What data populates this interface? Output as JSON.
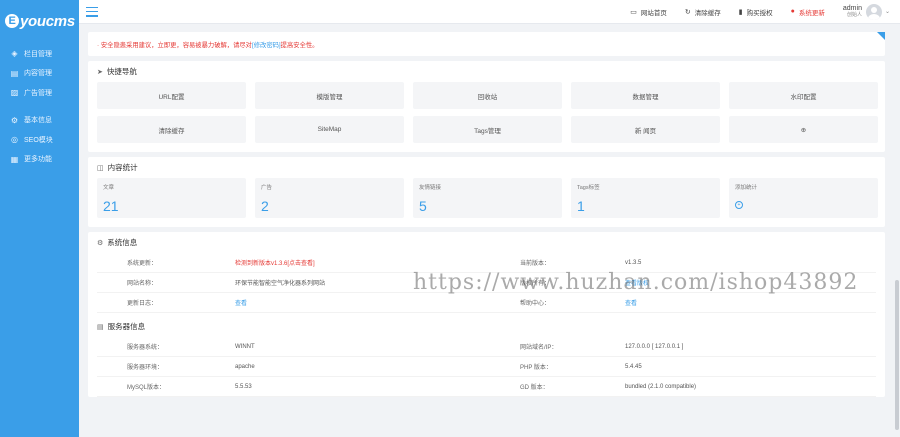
{
  "brand": {
    "logo_letter": "E",
    "logo_text": "youcms"
  },
  "sidebar": {
    "items": [
      {
        "icon": "box-icon",
        "glyph": "◈",
        "label": "栏目管理"
      },
      {
        "icon": "document-icon",
        "glyph": "▤",
        "label": "内容管理"
      },
      {
        "icon": "image-icon",
        "glyph": "▨",
        "label": "广告管理"
      },
      {
        "icon": "gear-icon",
        "glyph": "⚙",
        "label": "基本信息"
      },
      {
        "icon": "globe-icon",
        "glyph": "◎",
        "label": "SEO模块"
      },
      {
        "icon": "grid-icon",
        "glyph": "▦",
        "label": "更多功能"
      }
    ]
  },
  "topbar": {
    "links": [
      {
        "icon": "monitor-icon",
        "glyph": "▭",
        "label": "网站首页"
      },
      {
        "icon": "refresh-icon",
        "glyph": "↻",
        "label": "清除缓存"
      },
      {
        "icon": "bookmark-icon",
        "glyph": "▮",
        "label": "购买授权"
      },
      {
        "icon": "alert-icon",
        "glyph": "●",
        "label": "系统更新"
      }
    ],
    "user_name": "admin",
    "user_role": "创始人"
  },
  "notice": {
    "text": "· 安全隐患采用建议，立即更，容易被暴力破解，请尽对",
    "link": "[修改密码]",
    "suffix": "提高安全性。"
  },
  "quick": {
    "title": "快捷导航",
    "items": [
      "URL配置",
      "模版管理",
      "回收站",
      "数据管理",
      "水印配置",
      "清除缓存",
      "SiteMap",
      "Tags管理",
      "新 闻页",
      ""
    ]
  },
  "stats": {
    "title": "内容统计",
    "items": [
      {
        "label": "文章",
        "value": "21"
      },
      {
        "label": "广告",
        "value": "2"
      },
      {
        "label": "友情链接",
        "value": "5"
      },
      {
        "label": "Tags标签",
        "value": "1"
      },
      {
        "label": "添加统计",
        "value": ""
      }
    ]
  },
  "system": {
    "title": "系统信息",
    "rows": [
      {
        "l1": "系统更新：",
        "v1": "检测到新版本v1.3.6[点击查看]",
        "l2": "当前版本：",
        "v2": "v1.3.5"
      },
      {
        "l1": "网站名称：",
        "v1": "环保节能智能空气净化器系列网站",
        "l2": "版权所有：",
        "v2": "查看版权"
      },
      {
        "l1": "更新日志：",
        "v1": "查看",
        "l2": "帮助中心：",
        "v2": "查看"
      }
    ]
  },
  "server": {
    "title": "服务器信息",
    "rows": [
      {
        "l1": "服务器系统：",
        "v1": "WINNT",
        "l2": "网站域名/IP：",
        "v2": "127.0.0.0 [ 127.0.0.1 ]"
      },
      {
        "l1": "服务器环境：",
        "v1": "apache",
        "l2": "PHP 版本：",
        "v2": "5.4.45"
      },
      {
        "l1": "MySQL版本：",
        "v1": "5.5.53",
        "l2": "GD 版本：",
        "v2": "bundled (2.1.0 compatible)"
      }
    ]
  },
  "watermark": "https://www.huzhan.com/ishop43892"
}
